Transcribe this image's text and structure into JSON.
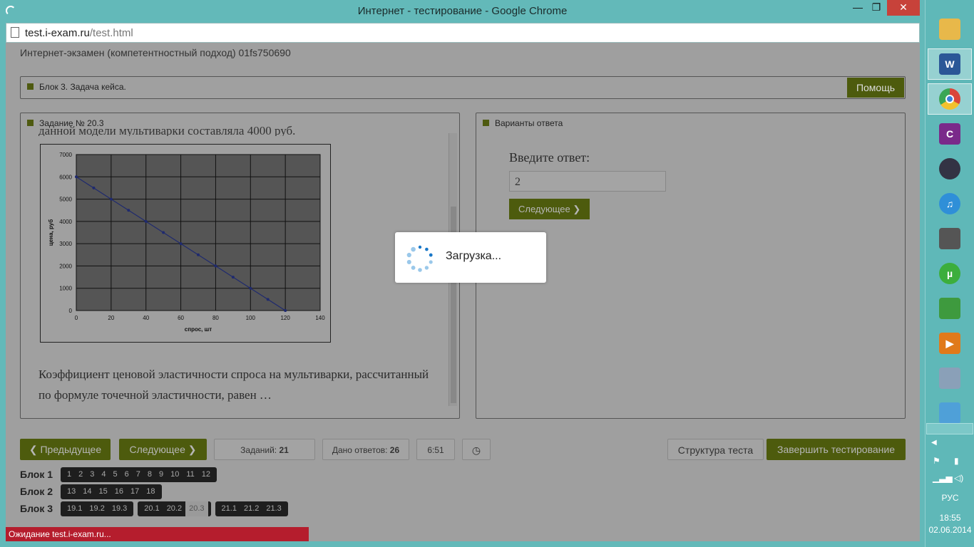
{
  "window": {
    "title": "Интернет - тестирование - Google Chrome",
    "min_glyph": "—",
    "max_glyph": "❐",
    "close_glyph": "✕"
  },
  "urlbar": {
    "host": "test.i-exam.ru",
    "path": "/test.html"
  },
  "exam": {
    "title": "Интернет-экзамен (компетентностный подход) 01fs750690"
  },
  "block_panel": {
    "label": "Блок 3. Задача кейса.",
    "help_label": "Помощь"
  },
  "task": {
    "header": "Задание № 20.3",
    "text_top": "данной модели мультиварки составляла 4000 руб.",
    "question": "Коэффициент ценовой эластичности спроса на мультиварки, рассчитанный по формуле точечной эластичности, равен …"
  },
  "answer": {
    "header": "Варианты ответа",
    "label": "Введите ответ:",
    "value": "2",
    "next_label": "Следующее"
  },
  "nav": {
    "prev_label": "Предыдущее",
    "next_label": "Следующее",
    "tasks_label": "Заданий:",
    "tasks_value": "21",
    "answers_label": "Дано ответов:",
    "answers_value": "26",
    "timer": "6:51",
    "structure_label": "Структура теста",
    "finish_label": "Завершить тестирование"
  },
  "blocks": [
    {
      "label": "Блок 1",
      "groups": [
        [
          "1",
          "2",
          "3",
          "4",
          "5",
          "6",
          "7",
          "8",
          "9",
          "10",
          "11",
          "12"
        ]
      ]
    },
    {
      "label": "Блок 2",
      "groups": [
        [
          "13",
          "14",
          "15",
          "16",
          "17",
          "18"
        ]
      ]
    },
    {
      "label": "Блок 3",
      "groups": [
        [
          "19.1",
          "19.2",
          "19.3"
        ],
        [
          "20.1",
          "20.2",
          "20.3"
        ],
        [
          "21.1",
          "21.2",
          "21.3"
        ]
      ]
    }
  ],
  "current_task": "20.3",
  "loading": {
    "text": "Загрузка..."
  },
  "status": {
    "text": "Ожидание test.i-exam.ru..."
  },
  "taskbar": {
    "items": [
      {
        "name": "file-explorer-icon",
        "color": "#e8b84a"
      },
      {
        "name": "word-icon",
        "color": "#2b5797",
        "glyph": "W",
        "active": true
      },
      {
        "name": "chrome-icon",
        "color": "#d9463a",
        "active": true
      },
      {
        "name": "app-c-icon",
        "color": "#7a2a8a",
        "glyph": "C"
      },
      {
        "name": "media-center-icon",
        "color": "#333344"
      },
      {
        "name": "itunes-icon",
        "color": "#2f8fd8",
        "glyph": "♫"
      },
      {
        "name": "device-icon",
        "color": "#555555"
      },
      {
        "name": "utorrent-icon",
        "color": "#3cae3c",
        "glyph": "µ"
      },
      {
        "name": "search-globe-icon",
        "color": "#3e9a3e"
      },
      {
        "name": "media-player-icon",
        "color": "#e07a1a",
        "glyph": "▶"
      },
      {
        "name": "camera-icon",
        "color": "#8aa0b8"
      },
      {
        "name": "paint-icon",
        "color": "#4fa0d8"
      }
    ],
    "lang": "РУС",
    "time": "18:55",
    "date": "02.06.2014"
  },
  "chart_data": {
    "type": "line",
    "title": "",
    "xlabel": "спрос, шт",
    "ylabel": "цена, руб",
    "xlim": [
      0,
      140
    ],
    "ylim": [
      0,
      7000
    ],
    "xticks": [
      0,
      20,
      40,
      60,
      80,
      100,
      120,
      140
    ],
    "yticks": [
      0,
      1000,
      2000,
      3000,
      4000,
      5000,
      6000,
      7000
    ],
    "grid": true,
    "series": [
      {
        "x": [
          0,
          10,
          20,
          30,
          40,
          50,
          60,
          70,
          80,
          90,
          100,
          110,
          120
        ],
        "values": [
          6000,
          5500,
          5000,
          4500,
          4000,
          3500,
          3000,
          2500,
          2000,
          1500,
          1000,
          500,
          0
        ],
        "color": "#1f2a6e"
      }
    ]
  }
}
